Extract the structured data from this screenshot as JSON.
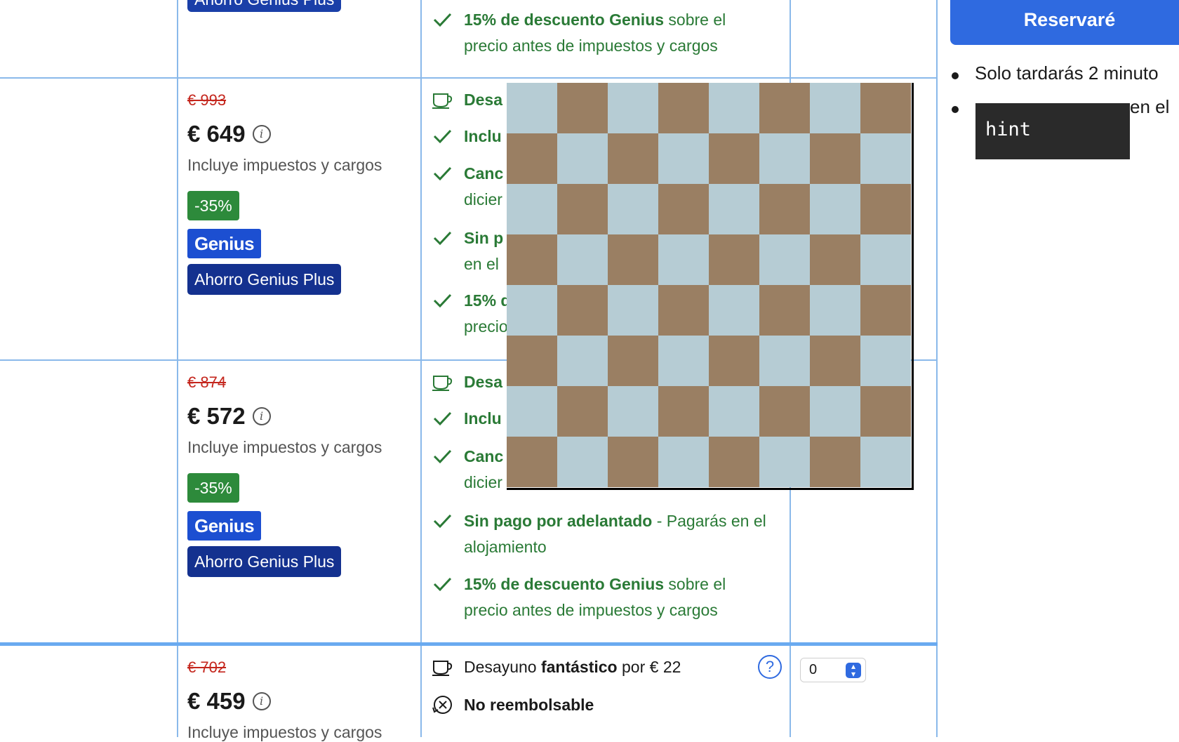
{
  "rows": [
    {
      "plus_badge": "Ahorro Genius Plus",
      "genius_feature": {
        "bold": "15% de descuento Genius",
        "rest": " sobre el precio antes de impuestos y cargos"
      }
    },
    {
      "old_price": "€ 993",
      "price": "€ 649",
      "tax_note": "Incluye impuestos y cargos",
      "discount": "-35%",
      "genius": "Genius",
      "plus_badge": "Ahorro Genius Plus",
      "features": [
        "Desa",
        "Inclu",
        "Canc",
        "dicier",
        "Sin p",
        "en el",
        "15% d",
        "precio"
      ]
    },
    {
      "old_price": "€ 874",
      "price": "€ 572",
      "tax_note": "Incluye impuestos y cargos",
      "discount": "-35%",
      "genius": "Genius",
      "plus_badge": "Ahorro Genius Plus",
      "features_visible": [
        "Desa",
        "Inclu",
        "Canc",
        "dicier"
      ],
      "payment": {
        "bold": "Sin pago por adelantado",
        "rest": " - Pagarás en el alojamiento"
      },
      "genius_feature": {
        "bold": "15% de descuento Genius",
        "rest": " sobre el precio antes de impuestos y cargos"
      }
    },
    {
      "old_price": "€ 702",
      "price": "€ 459",
      "tax_note": "Incluye impuestos y cargos",
      "breakfast": {
        "pre": "Desayuno ",
        "bold": "fantástico",
        "post": " por € 22"
      },
      "refund": "No reembolsable",
      "help_icon": "?",
      "quantity": "0"
    }
  ],
  "sidebar": {
    "reserve_button": "Reservaré",
    "bullets": [
      "Solo tardarás 2 minuto",
      "en el"
    ]
  },
  "tooltip": "hint",
  "board": {
    "rows": 8,
    "cols": 8,
    "light_color": "#b6ccd4",
    "dark_color": "#9a7f63"
  },
  "colors": {
    "grid_line": "#8ab9ea",
    "green": "#2a7a36",
    "red": "#c4251c",
    "genius_blue": "#1c4fd1",
    "plus_blue": "#14318f",
    "button_blue": "#2f6ae0"
  }
}
